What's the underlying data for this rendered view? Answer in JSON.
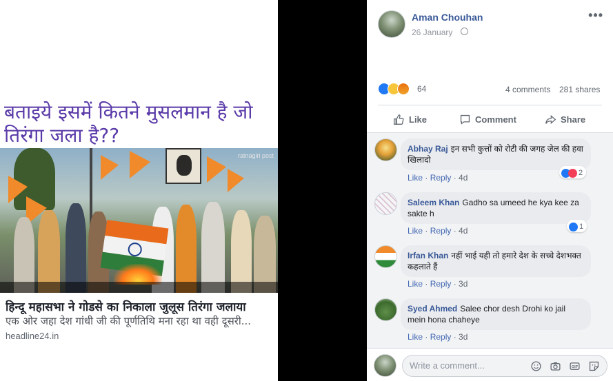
{
  "shared_image": {
    "headline_hindi": "बताइये इसमें कितने मुसलमान है जो तिरंगा जला है??",
    "scene_watermark": "ratnagiri post",
    "news_title": "हिन्दू महासभा ने गोडसे का निकाला जुलूस तिरंगा जलाया",
    "news_description": "एक ओर जहा देश गांधी जी की पूर्णतिथि मना रहा था वही दूसरी...",
    "news_domain": "headline24.in"
  },
  "post": {
    "author": "Aman Chouhan",
    "date": "26 January",
    "more_label": "•••",
    "reaction_count": "64",
    "comments_count": "4 comments",
    "shares_count": "281 shares",
    "actions": {
      "like": "Like",
      "comment": "Comment",
      "share": "Share"
    }
  },
  "comments": [
    {
      "name": "Abhay Raj",
      "text": "इन सभी कुत्तों को रोटी की जगह जेल की हवा खिलादो",
      "like": "Like",
      "reply": "Reply",
      "time": "4d",
      "reaction_count": "2"
    },
    {
      "name": "Saleem Khan",
      "text": "Gadho sa umeed he kya kee za sakte h",
      "like": "Like",
      "reply": "Reply",
      "time": "4d",
      "reaction_count": "1"
    },
    {
      "name": "Irfan Khan",
      "text": "नहीं भाई यही तो हमारे देश के सच्चे देशभक्त कहलाते हैं",
      "like": "Like",
      "reply": "Reply",
      "time": "3d"
    },
    {
      "name": "Syed Ahmed",
      "text": "Salee chor desh Drohi ko jail mein hona chaheye",
      "like": "Like",
      "reply": "Reply",
      "time": "3d"
    }
  ],
  "composer": {
    "placeholder": "Write a comment..."
  },
  "colors": {
    "link": "#385898",
    "accent": "#4267b2",
    "like_blue": "#2078f4",
    "saffron": "#f08a2a"
  }
}
